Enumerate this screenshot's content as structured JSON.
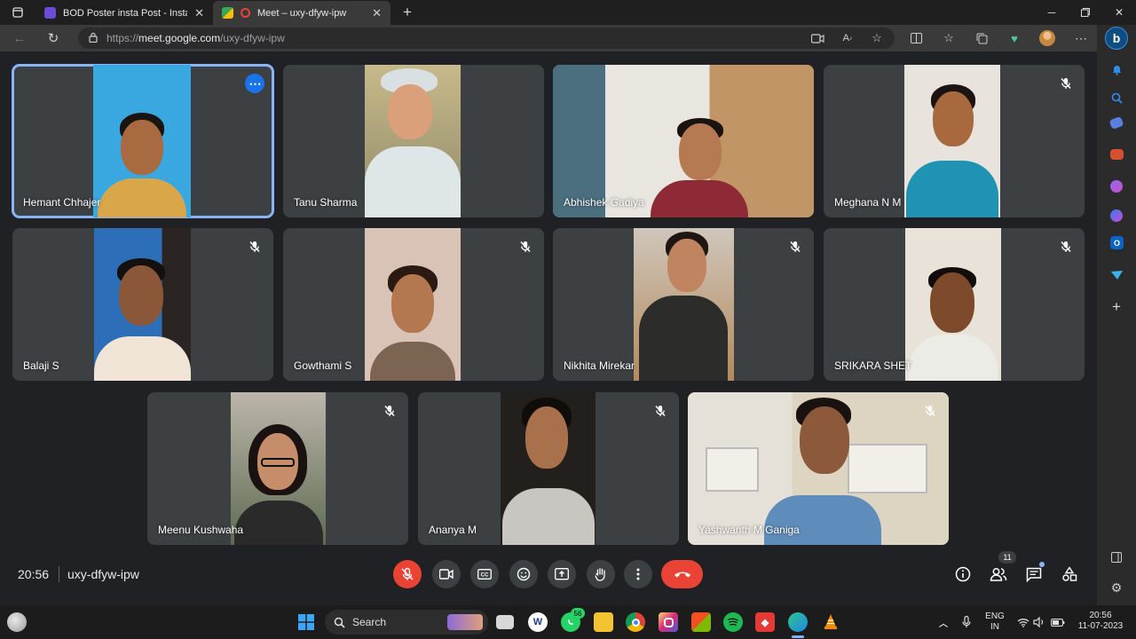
{
  "browser": {
    "tabs": [
      {
        "title": "BOD Poster insta Post - Instagram",
        "active": false
      },
      {
        "title": "Meet – uxy-dfyw-ipw",
        "active": true
      }
    ],
    "url_scheme": "https://",
    "url_host": "meet.google.com",
    "url_path": "/uxy-dfyw-ipw"
  },
  "meeting": {
    "time": "20:56",
    "code": "uxy-dfyw-ipw",
    "participant_count": "11"
  },
  "participants": [
    {
      "name": "Hemant Chhajer",
      "speaking": true,
      "muted": false
    },
    {
      "name": "Tanu Sharma",
      "muted": false
    },
    {
      "name": "Abhishek Gadiya",
      "muted": false
    },
    {
      "name": "Meghana N M",
      "muted": true
    },
    {
      "name": "Balaji S",
      "muted": true
    },
    {
      "name": "Gowthami S",
      "muted": true
    },
    {
      "name": "Nikhita Mirekar",
      "muted": true
    },
    {
      "name": "SRIKARA SHET",
      "muted": true
    },
    {
      "name": "Meenu Kushwaha",
      "muted": true
    },
    {
      "name": "Ananya M",
      "muted": true
    },
    {
      "name": "Yashwanth M Ganiga",
      "muted": true
    }
  ],
  "taskbar": {
    "search_label": "Search",
    "whatsapp_badge": "56",
    "lang_line1": "ENG",
    "lang_line2": "IN",
    "clock_time": "20:56",
    "clock_date": "11-07-2023"
  },
  "colors": {
    "meet_bg": "#202124",
    "tile_bg": "#3c4043",
    "speaking_outline": "#8ab4f8",
    "end_call": "#ea4335"
  }
}
